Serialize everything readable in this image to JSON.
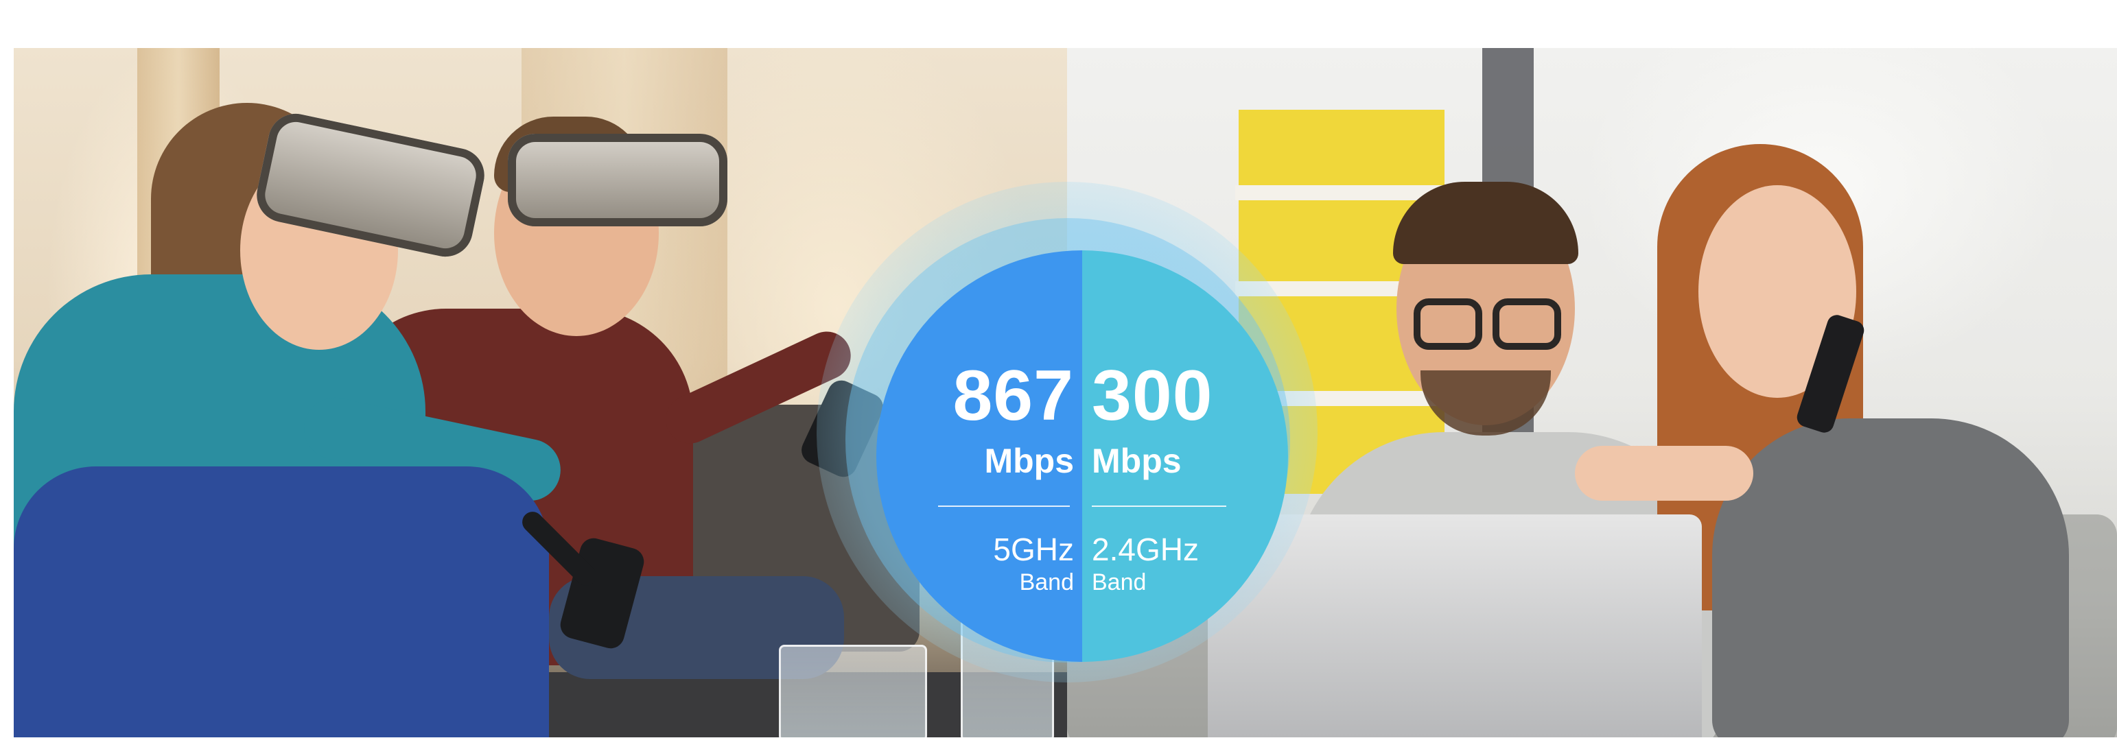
{
  "speed_badge": {
    "band_5ghz": {
      "speed": "867",
      "unit": "Mbps",
      "frequency": "5GHz",
      "label": "Band",
      "color": "#3d96ef"
    },
    "band_24ghz": {
      "speed": "300",
      "unit": "Mbps",
      "frequency": "2.4GHz",
      "label": "Band",
      "color": "#4fc3de"
    }
  },
  "scenes": {
    "left": "vr-gaming",
    "right": "laptop-and-phone"
  }
}
